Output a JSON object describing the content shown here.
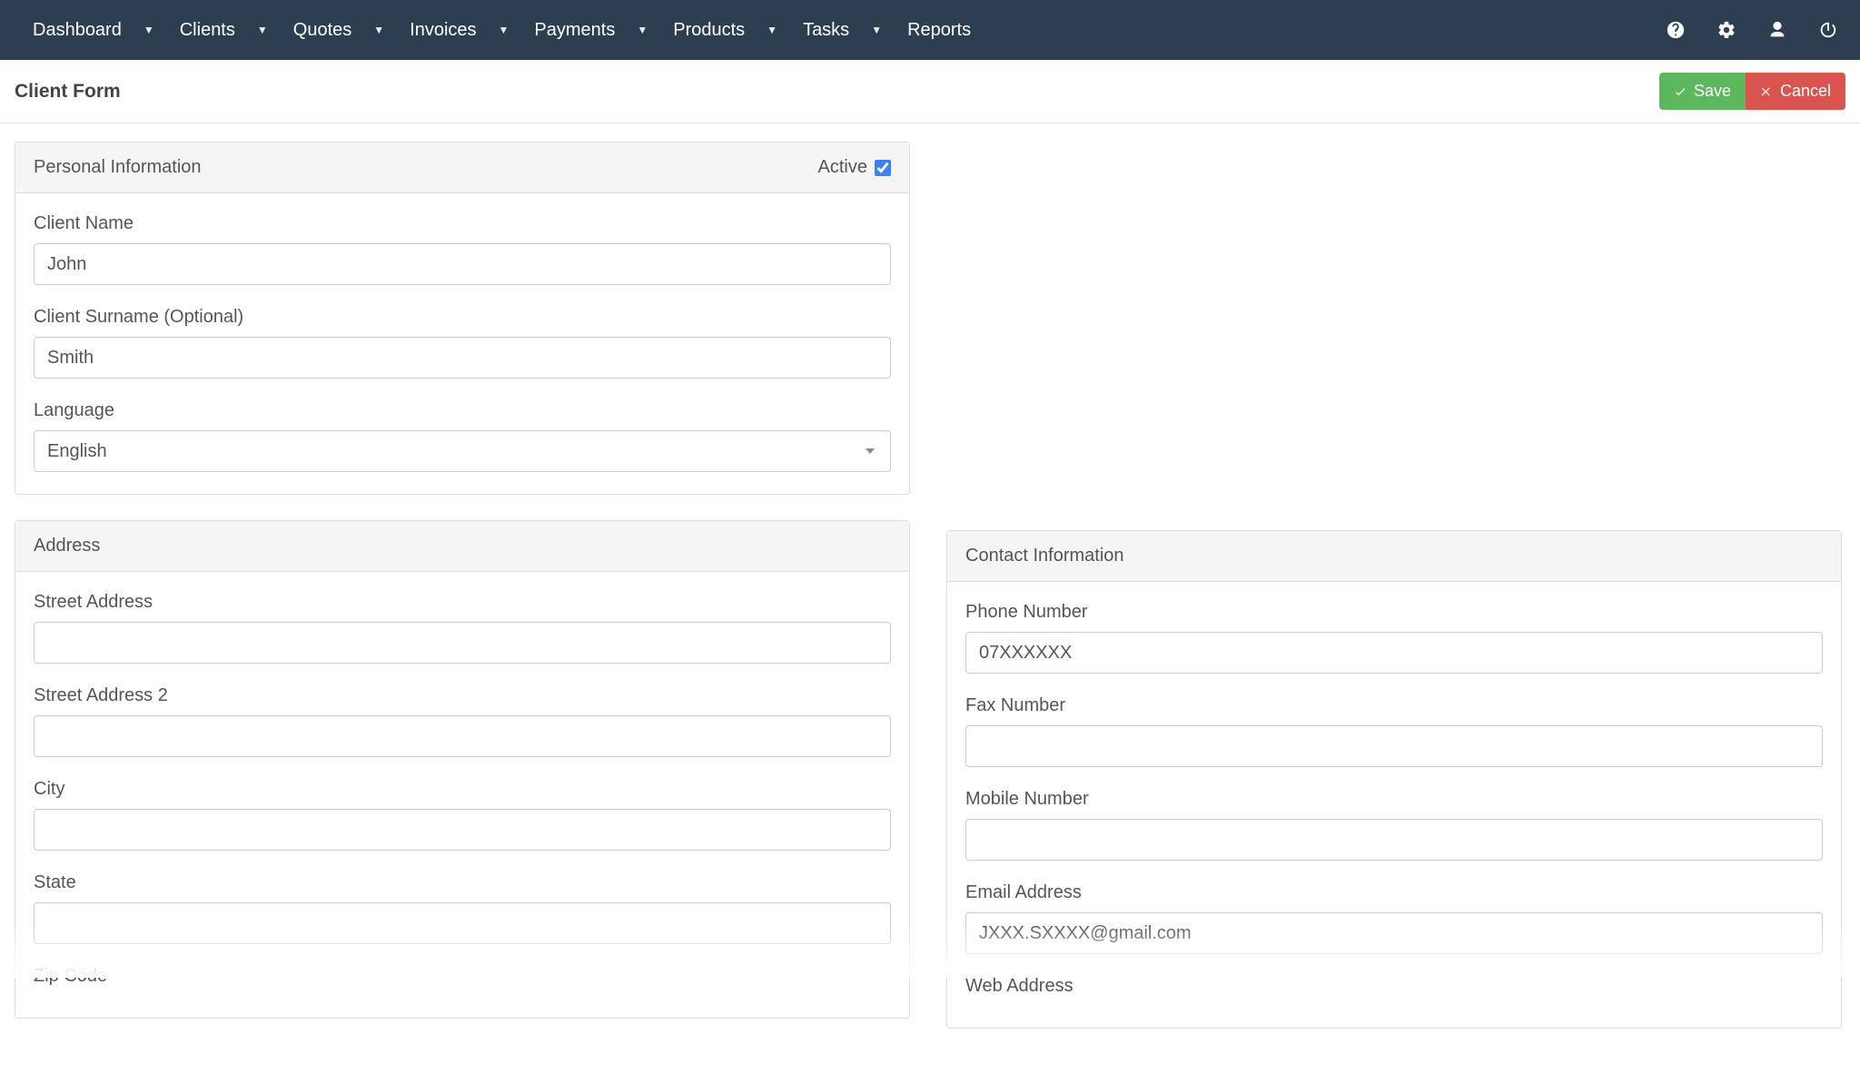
{
  "nav": {
    "items": [
      {
        "label": "Dashboard",
        "hasCaret": true
      },
      {
        "label": "Clients",
        "hasCaret": true
      },
      {
        "label": "Quotes",
        "hasCaret": true
      },
      {
        "label": "Invoices",
        "hasCaret": true
      },
      {
        "label": "Payments",
        "hasCaret": true
      },
      {
        "label": "Products",
        "hasCaret": true
      },
      {
        "label": "Tasks",
        "hasCaret": true
      },
      {
        "label": "Reports",
        "hasCaret": false
      }
    ],
    "icons": [
      "help",
      "settings",
      "user",
      "power"
    ]
  },
  "header": {
    "title": "Client Form",
    "save_label": "Save",
    "cancel_label": "Cancel"
  },
  "personal": {
    "panel_title": "Personal Information",
    "active_label": "Active",
    "active_checked": true,
    "client_name_label": "Client Name",
    "client_name_value": "John",
    "client_surname_label": "Client Surname (Optional)",
    "client_surname_value": "Smith",
    "language_label": "Language",
    "language_value": "English"
  },
  "address": {
    "panel_title": "Address",
    "street_label": "Street Address",
    "street_value": "",
    "street2_label": "Street Address 2",
    "street2_value": "",
    "city_label": "City",
    "city_value": "",
    "state_label": "State",
    "state_value": "",
    "zip_label": "Zip Code"
  },
  "contact": {
    "panel_title": "Contact Information",
    "phone_label": "Phone Number",
    "phone_value": "07XXXXXX",
    "fax_label": "Fax Number",
    "fax_value": "",
    "mobile_label": "Mobile Number",
    "mobile_value": "",
    "email_label": "Email Address",
    "email_value": "JXXX.SXXXX@gmail.com",
    "web_label": "Web Address"
  }
}
